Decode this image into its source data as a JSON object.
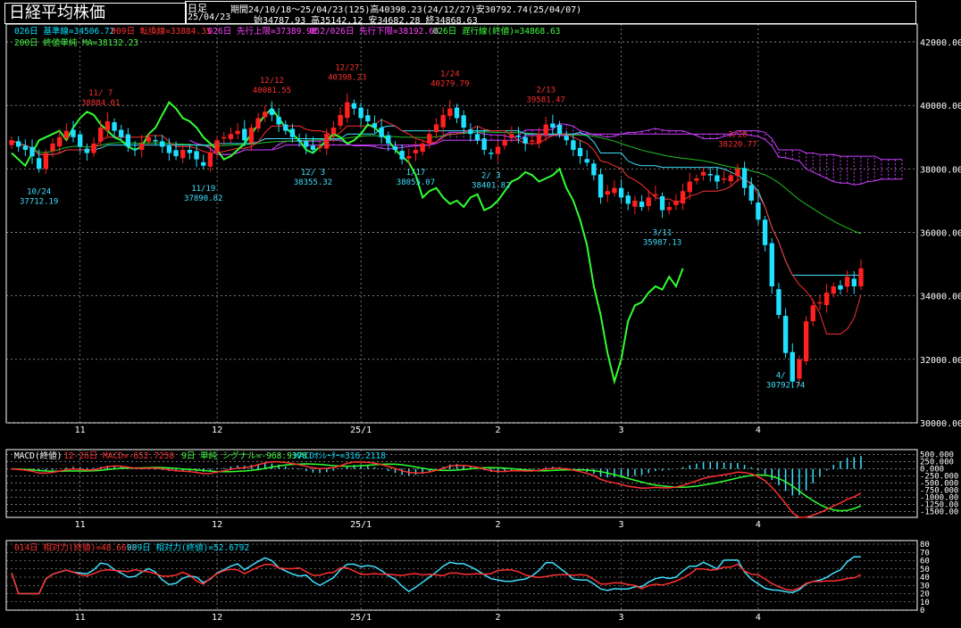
{
  "title": "日経平均株価",
  "header": {
    "period_type": "日足",
    "period": "期間24/10/18〜25/04/23(125)高40398.23(24/12/27)安30792.74(25/04/07)",
    "date": "25/04/23",
    "ohlc": "始34787.93 高35142.12 安34682.28 終34868.63"
  },
  "legend": {
    "line1": [
      {
        "text": "026日 基準線=34506.72",
        "color": "#00e0ff"
      },
      {
        "text": "009日 転換線=33884.35",
        "color": "#ff3030"
      },
      {
        "text": "026日 先行上限=37389.98",
        "color": "#ff40ff"
      },
      {
        "text": "052/026日 先行下限=38192.68",
        "color": "#ff40ff"
      },
      {
        "text": "026日 遅行線(終値)=34868.63",
        "color": "#40ff40"
      }
    ],
    "line2": [
      {
        "text": "200日 終値単純 MA=38132.23",
        "color": "#40ff40"
      }
    ],
    "macd": [
      {
        "text": "MACD(終値)",
        "color": "#ffffff"
      },
      {
        "text": "12-26日 MACD=-652.7258",
        "color": "#ff3030"
      },
      {
        "text": "9日 単純 シグナル=-968.9378",
        "color": "#40ff40"
      },
      {
        "text": "MACDｵｼﾚｰﾀｰ=316.2118",
        "color": "#00e0ff"
      }
    ],
    "rsi": [
      {
        "text": "014日 相対力(終値)=48.6698",
        "color": "#ff3030"
      },
      {
        "text": "009日 相対力(終値)=52.6792",
        "color": "#00e0ff"
      }
    ]
  },
  "colors": {
    "up": "#ff2020",
    "down": "#20e0ff",
    "cloud": "#cc40ff",
    "lagging": "#30ff30",
    "ma200": "#20c020",
    "kijun": "#40e0ff",
    "tenkan": "#ff3030",
    "grid": "#bbbbbb"
  },
  "chart_data": {
    "type": "candlestick",
    "price_axis": {
      "min": 30000,
      "max": 42000,
      "ticks": [
        "42000.00",
        "40000.00",
        "38000.00",
        "36000.00",
        "34000.00",
        "32000.00",
        "30000.00"
      ]
    },
    "macd_axis": {
      "min": -1700,
      "max": 550,
      "ticks": [
        "500.000",
        "250.000",
        "0.000",
        "-250.000",
        "-500.000",
        "-750.000",
        "-1000.00",
        "-1250.00",
        "-1500.00"
      ]
    },
    "rsi_axis": {
      "min": 0,
      "max": 80,
      "ticks": [
        "80",
        "70",
        "60",
        "50",
        "40",
        "30",
        "20",
        "10",
        "0"
      ]
    },
    "x_labels": [
      {
        "label": "11",
        "index": 10
      },
      {
        "label": "12",
        "index": 30
      },
      {
        "label": "25/1",
        "index": 51
      },
      {
        "label": "2",
        "index": 71
      },
      {
        "label": "3",
        "index": 89
      },
      {
        "label": "4",
        "index": 109
      }
    ],
    "annotations": [
      {
        "date": "11/ 7",
        "value": "38884.01",
        "index": 13,
        "kind": "high"
      },
      {
        "date": "12/12",
        "value": "40081.55",
        "index": 38,
        "kind": "high"
      },
      {
        "date": "12/27",
        "value": "40398.23",
        "index": 49,
        "kind": "high"
      },
      {
        "date": "1/24",
        "value": "40279.79",
        "index": 64,
        "kind": "high"
      },
      {
        "date": "2/13",
        "value": "39581.47",
        "index": 78,
        "kind": "high"
      },
      {
        "date": "3/28",
        "value": "38220.77",
        "index": 106,
        "kind": "high"
      },
      {
        "date": "10/24",
        "value": "37712.19",
        "index": 4,
        "kind": "low"
      },
      {
        "date": "11/19",
        "value": "37890.82",
        "index": 28,
        "kind": "low"
      },
      {
        "date": "12/ 3",
        "value": "38355.32",
        "index": 44,
        "kind": "low"
      },
      {
        "date": "1/17",
        "value": "38055.07",
        "index": 59,
        "kind": "low"
      },
      {
        "date": "2/ 3",
        "value": "38401.82",
        "index": 70,
        "kind": "low"
      },
      {
        "date": "3/11",
        "value": "35987.13",
        "index": 95,
        "kind": "low"
      },
      {
        "date": "4/ 7",
        "value": "30792.74",
        "index": 113,
        "kind": "low"
      }
    ],
    "close": [
      38900,
      38700,
      38600,
      38400,
      38000,
      38500,
      38800,
      39000,
      39200,
      39000,
      38700,
      38500,
      38800,
      39300,
      39500,
      39200,
      39000,
      38700,
      38600,
      38800,
      39000,
      38900,
      38700,
      38500,
      38400,
      38600,
      38500,
      38300,
      38100,
      38500,
      38900,
      39000,
      39100,
      39200,
      38900,
      39300,
      39600,
      39800,
      39700,
      39400,
      39200,
      39000,
      38900,
      38700,
      38600,
      38700,
      39100,
      39300,
      39700,
      40100,
      39900,
      39600,
      39500,
      39300,
      39000,
      38800,
      38600,
      38300,
      38400,
      38600,
      38800,
      39100,
      39400,
      39700,
      39900,
      39600,
      39300,
      39100,
      38900,
      38600,
      38500,
      38700,
      38900,
      39100,
      39000,
      38800,
      38900,
      39100,
      39400,
      39300,
      39100,
      38900,
      38600,
      38400,
      38200,
      37800,
      37100,
      37300,
      37400,
      37100,
      36900,
      37000,
      36800,
      37100,
      37200,
      36700,
      36800,
      37000,
      37300,
      37600,
      37700,
      37900,
      37800,
      37600,
      37700,
      37800,
      38000,
      37400,
      37000,
      36400,
      35600,
      34300,
      33400,
      32200,
      31300,
      32000,
      33200,
      33700,
      33800,
      34100,
      34300,
      34200,
      34600,
      34300,
      34868
    ]
  }
}
